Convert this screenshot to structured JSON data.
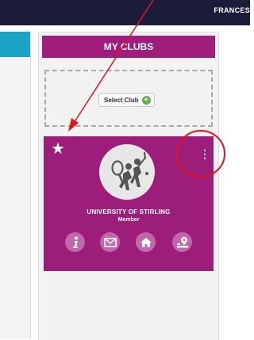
{
  "header": {
    "user_name": "FRANCES"
  },
  "clubs_panel": {
    "title": "MY CLUBS",
    "select_button_label": "Select Club"
  },
  "club_card": {
    "name": "UNIVERSITY OF STIRLING",
    "role": "Member",
    "favorite_icon": "star-icon",
    "menu_icon": "vertical-dots-icon",
    "actions": [
      {
        "icon": "info-icon"
      },
      {
        "icon": "mail-icon"
      },
      {
        "icon": "home-icon"
      },
      {
        "icon": "location-icon"
      }
    ]
  },
  "colors": {
    "brand": "#9c1d7a",
    "topbar": "#1b1b3a",
    "accent": "#1aa3c4",
    "annotation": "#e5121b"
  }
}
